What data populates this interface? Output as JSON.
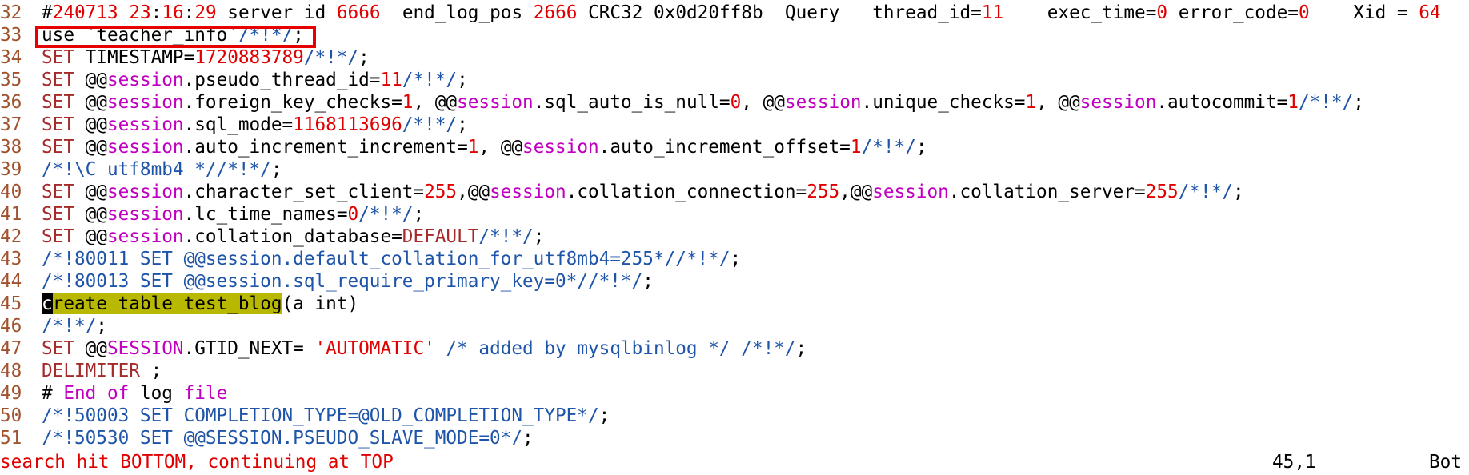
{
  "lines": [
    {
      "n": "32",
      "text": "#240713 23:16:29 server id 6666  end_log_pos 2666 CRC32 0x0d20ff8b  Query   thread_id=11    exec_time=0 error_code=0    Xid = 64"
    },
    {
      "n": "33",
      "text": "use `teacher_info`/*!*/;"
    },
    {
      "n": "34",
      "text": "SET TIMESTAMP=1720883789/*!*/;"
    },
    {
      "n": "35",
      "text": "SET @@session.pseudo_thread_id=11/*!*/;"
    },
    {
      "n": "36",
      "text": "SET @@session.foreign_key_checks=1, @@session.sql_auto_is_null=0, @@session.unique_checks=1, @@session.autocommit=1/*!*/;"
    },
    {
      "n": "37",
      "text": "SET @@session.sql_mode=1168113696/*!*/;"
    },
    {
      "n": "38",
      "text": "SET @@session.auto_increment_increment=1, @@session.auto_increment_offset=1/*!*/;"
    },
    {
      "n": "39",
      "text": "/*!\\C utf8mb4 *//*!*/;"
    },
    {
      "n": "40",
      "text": "SET @@session.character_set_client=255,@@session.collation_connection=255,@@session.collation_server=255/*!*/;"
    },
    {
      "n": "41",
      "text": "SET @@session.lc_time_names=0/*!*/;"
    },
    {
      "n": "42",
      "text": "SET @@session.collation_database=DEFAULT/*!*/;"
    },
    {
      "n": "43",
      "text": "/*!80011 SET @@session.default_collation_for_utf8mb4=255*//*!*/;"
    },
    {
      "n": "44",
      "text": "/*!80013 SET @@session.sql_require_primary_key=0*//*!*/;"
    },
    {
      "n": "45",
      "text": "create table test_blog(a int)"
    },
    {
      "n": "46",
      "text": "/*!*/;"
    },
    {
      "n": "47",
      "text": "SET @@SESSION.GTID_NEXT= 'AUTOMATIC' /* added by mysqlbinlog */ /*!*/;"
    },
    {
      "n": "48",
      "text": "DELIMITER ;"
    },
    {
      "n": "49",
      "text": "# End of log file"
    },
    {
      "n": "50",
      "text": "/*!50003 SET COMPLETION_TYPE=@OLD_COMPLETION_TYPE*/;"
    },
    {
      "n": "51",
      "text": "/*!50530 SET @@SESSION.PSEUDO_SLAVE_MODE=0*/;"
    }
  ],
  "status": {
    "message": "search hit BOTTOM, continuing at TOP",
    "position": "45,1",
    "scroll": "Bot"
  }
}
